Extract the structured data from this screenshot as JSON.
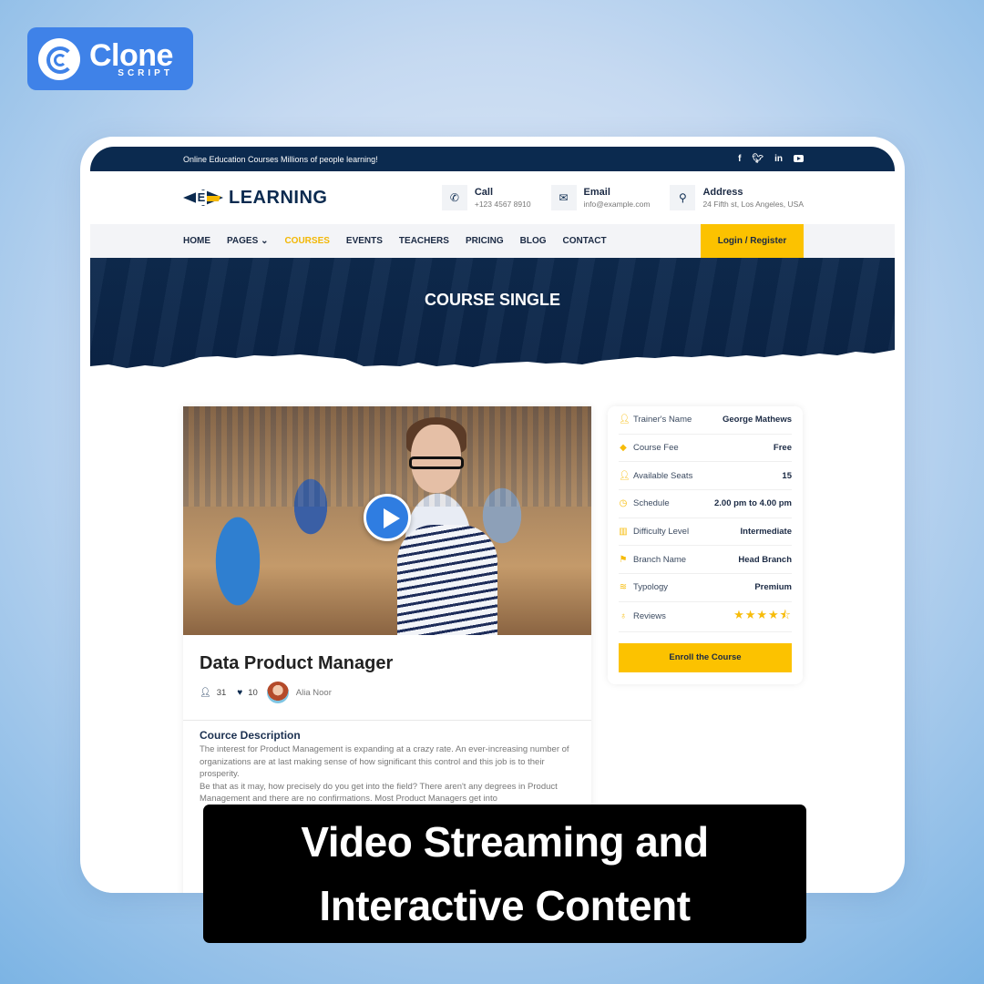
{
  "brand": {
    "name": "Clone",
    "sub": "SCRIPT"
  },
  "topbar": {
    "tagline": "Online Education Courses Millions of people learning!",
    "social": [
      "facebook",
      "twitter",
      "linkedin",
      "youtube"
    ]
  },
  "header": {
    "logo_letter": "E",
    "logo_text": "LEARNING",
    "contacts": [
      {
        "icon": "phone-icon",
        "title": "Call",
        "value": "+123 4567 8910"
      },
      {
        "icon": "envelope-icon",
        "title": "Email",
        "value": "info@example.com"
      },
      {
        "icon": "map-pin-icon",
        "title": "Address",
        "value": "24 Fifth st, Los Angeles, USA"
      }
    ]
  },
  "nav": {
    "items": [
      "HOME",
      "PAGES",
      "COURSES",
      "EVENTS",
      "TEACHERS",
      "PRICING",
      "BLOG",
      "CONTACT"
    ],
    "active": "COURSES",
    "login": "Login / Register"
  },
  "hero": {
    "title": "COURSE SINGLE"
  },
  "course": {
    "title": "Data Product Manager",
    "students": "31",
    "likes": "10",
    "author": "Alia Noor",
    "desc_title": "Cource Description",
    "desc_p1": "The interest for Product Management is expanding at a crazy rate. An ever-increasing number of organizations are at last making sense of how significant this control and this job is to their prosperity.",
    "desc_p2": "Be that as it may, how precisely do you get into the field? There aren't any degrees in Product Management and there are no confirmations. Most Product Managers get into"
  },
  "info": {
    "rows": [
      {
        "icon": "user-icon",
        "glyph": "👤",
        "label": "Trainer's Name",
        "value": "George Mathews"
      },
      {
        "icon": "tag-icon",
        "glyph": "🏷",
        "label": "Course Fee",
        "value": "Free"
      },
      {
        "icon": "user-icon",
        "glyph": "👤",
        "label": "Available Seats",
        "value": "15"
      },
      {
        "icon": "clock-icon",
        "glyph": "◷",
        "label": "Schedule",
        "value": "2.00 pm to 4.00 pm"
      },
      {
        "icon": "bar-chart-icon",
        "glyph": "▥",
        "label": "Difficulty Level",
        "value": "Intermediate"
      },
      {
        "icon": "flag-icon",
        "glyph": "⚑",
        "label": "Branch Name",
        "value": "Head Branch"
      },
      {
        "icon": "layers-icon",
        "glyph": "≋",
        "label": "Typology",
        "value": "Premium"
      }
    ],
    "reviews_label": "Reviews",
    "rating": 4.5,
    "rating_max": 5,
    "stars_display": "★★★★⯪",
    "enroll": "Enroll the Course"
  },
  "banner": {
    "line1": "Video Streaming and",
    "line2": "Interactive Content"
  }
}
